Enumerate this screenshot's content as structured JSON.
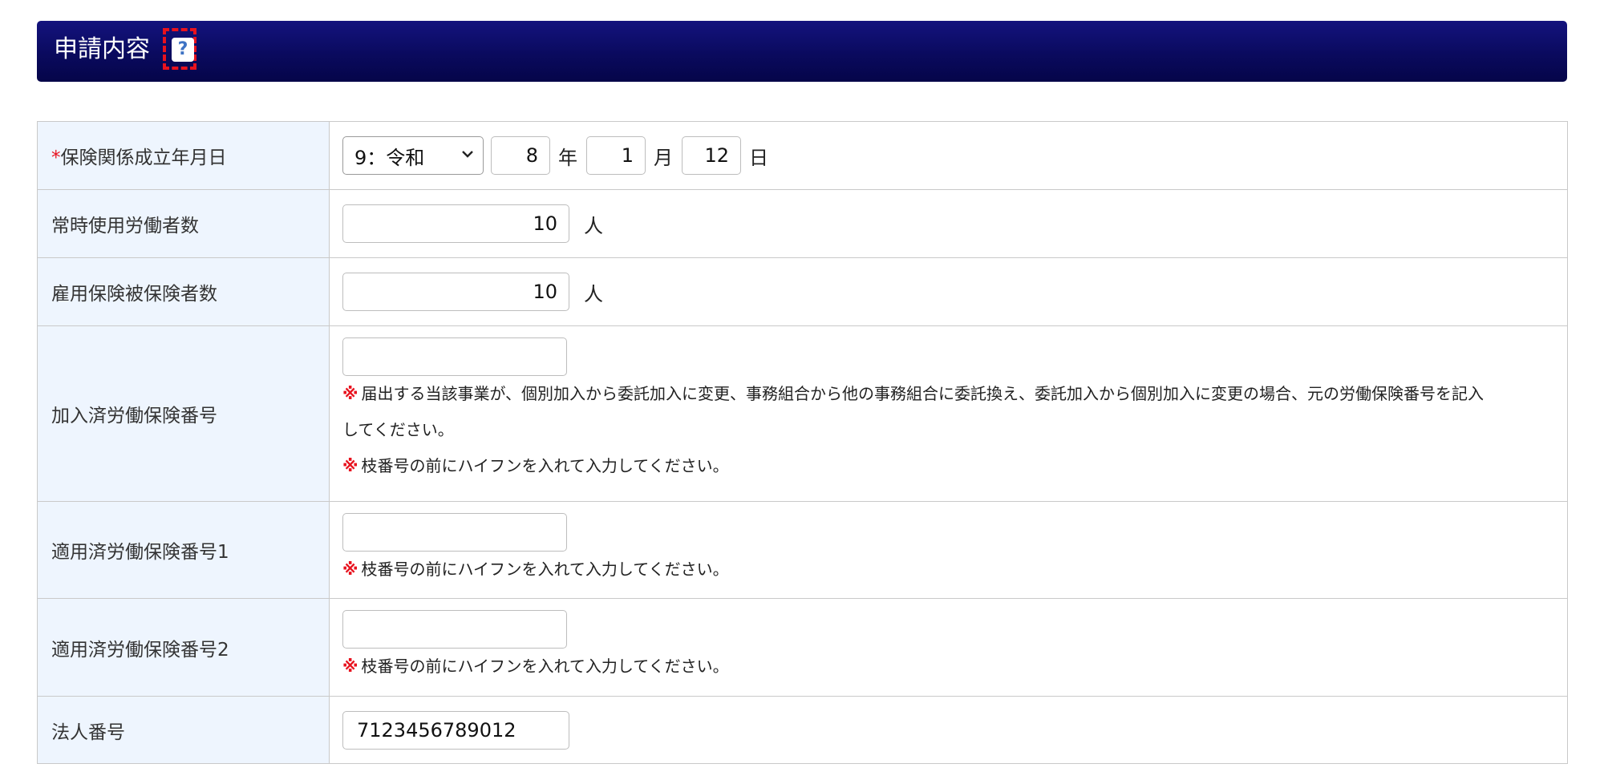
{
  "header": {
    "title": "申請内容",
    "help_label": "?"
  },
  "rows": {
    "date": {
      "required_mark": "*",
      "label": "保険関係成立年月日",
      "era_select": "9：令和",
      "year": "8",
      "year_unit": "年",
      "month": "1",
      "month_unit": "月",
      "day": "12",
      "day_unit": "日"
    },
    "workers": {
      "label": "常時使用労働者数",
      "value": "10",
      "unit": "人"
    },
    "insured": {
      "label": "雇用保険被保険者数",
      "value": "10",
      "unit": "人"
    },
    "joined_number": {
      "label": "加入済労働保険番号",
      "value": "",
      "note1_mark": "※",
      "note1_line1": "届出する当該事業が、個別加入から委託加入に変更、事務組合から他の事務組合に委託換え、委託加入から個別加入に変更の場合、元の労働保険番号を記入",
      "note1_line2": "してください。",
      "note2_mark": "※",
      "note2": "枝番号の前にハイフンを入れて入力してください。"
    },
    "applied_number1": {
      "label": "適用済労働保険番号1",
      "value": "",
      "note_mark": "※",
      "note": "枝番号の前にハイフンを入れて入力してください。"
    },
    "applied_number2": {
      "label": "適用済労働保険番号2",
      "value": "",
      "note_mark": "※",
      "note": "枝番号の前にハイフンを入れて入力してください。"
    },
    "corporate_number": {
      "label": "法人番号",
      "value": "7123456789012"
    }
  },
  "colors": {
    "header_bg": "#0a0a5e",
    "label_bg": "#eef5fe",
    "required": "#e8121e",
    "help_highlight": "#e8121e"
  }
}
